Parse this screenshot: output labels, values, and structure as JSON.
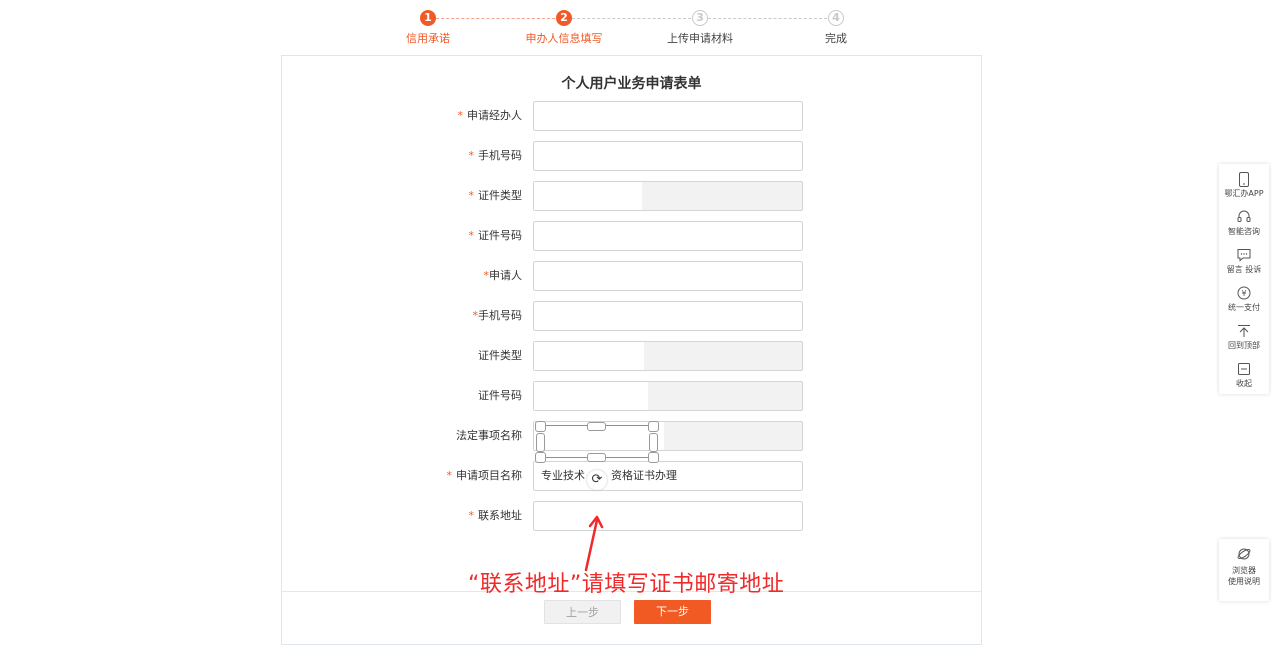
{
  "stepper": {
    "steps": [
      {
        "num": "1",
        "label": "信用承诺",
        "state": "active"
      },
      {
        "num": "2",
        "label": "申办人信息填写",
        "state": "active"
      },
      {
        "num": "3",
        "label": "上传申请材料",
        "state": "inactive"
      },
      {
        "num": "4",
        "label": "完成",
        "state": "inactive"
      }
    ]
  },
  "form": {
    "title": "个人用户业务申请表单",
    "fields": [
      {
        "label": "申请经办人",
        "required": true,
        "value": "",
        "disabled": false
      },
      {
        "label": "手机号码",
        "required": true,
        "value": "",
        "disabled": false
      },
      {
        "label": "证件类型",
        "required": true,
        "value": "",
        "disabled": true
      },
      {
        "label": "证件号码",
        "required": true,
        "value": "",
        "disabled": false
      },
      {
        "label": "申请人",
        "required": true,
        "value": "",
        "disabled": false
      },
      {
        "label": "手机号码",
        "required": true,
        "value": "",
        "disabled": false
      },
      {
        "label": "证件类型",
        "required": false,
        "value": "",
        "disabled": true
      },
      {
        "label": "证件号码",
        "required": false,
        "value": "",
        "disabled": true
      },
      {
        "label": "法定事项名称",
        "required": false,
        "value": "",
        "disabled": true
      },
      {
        "label": "申请项目名称",
        "required": true,
        "value_left": "专业技术",
        "value_right": "资格证书办理",
        "disabled": false
      },
      {
        "label": "联系地址",
        "required": true,
        "value": "",
        "disabled": false
      }
    ],
    "required_mark": "*"
  },
  "footer": {
    "prev_label": "上一步",
    "next_label": "下一步"
  },
  "annotation": {
    "text": "“联系地址”请填写证书邮寄地址",
    "color": "#f02a2a"
  },
  "sidebar": {
    "items": [
      {
        "icon": "phone-icon",
        "label": "鄂汇办APP"
      },
      {
        "icon": "headset-icon",
        "label": "智能咨询"
      },
      {
        "icon": "message-icon",
        "label": "留言 投诉"
      },
      {
        "icon": "yuan-icon",
        "label": "统一支付"
      },
      {
        "icon": "back-to-top-icon",
        "label": "回到顶部"
      },
      {
        "icon": "collapse-icon",
        "label": "收起"
      }
    ],
    "help": {
      "icon": "browser-icon",
      "line1": "浏览器",
      "line2": "使用说明"
    }
  },
  "colors": {
    "accent": "#f05a28",
    "next_button": "#f15a22",
    "selection": "#6a8ff0"
  }
}
